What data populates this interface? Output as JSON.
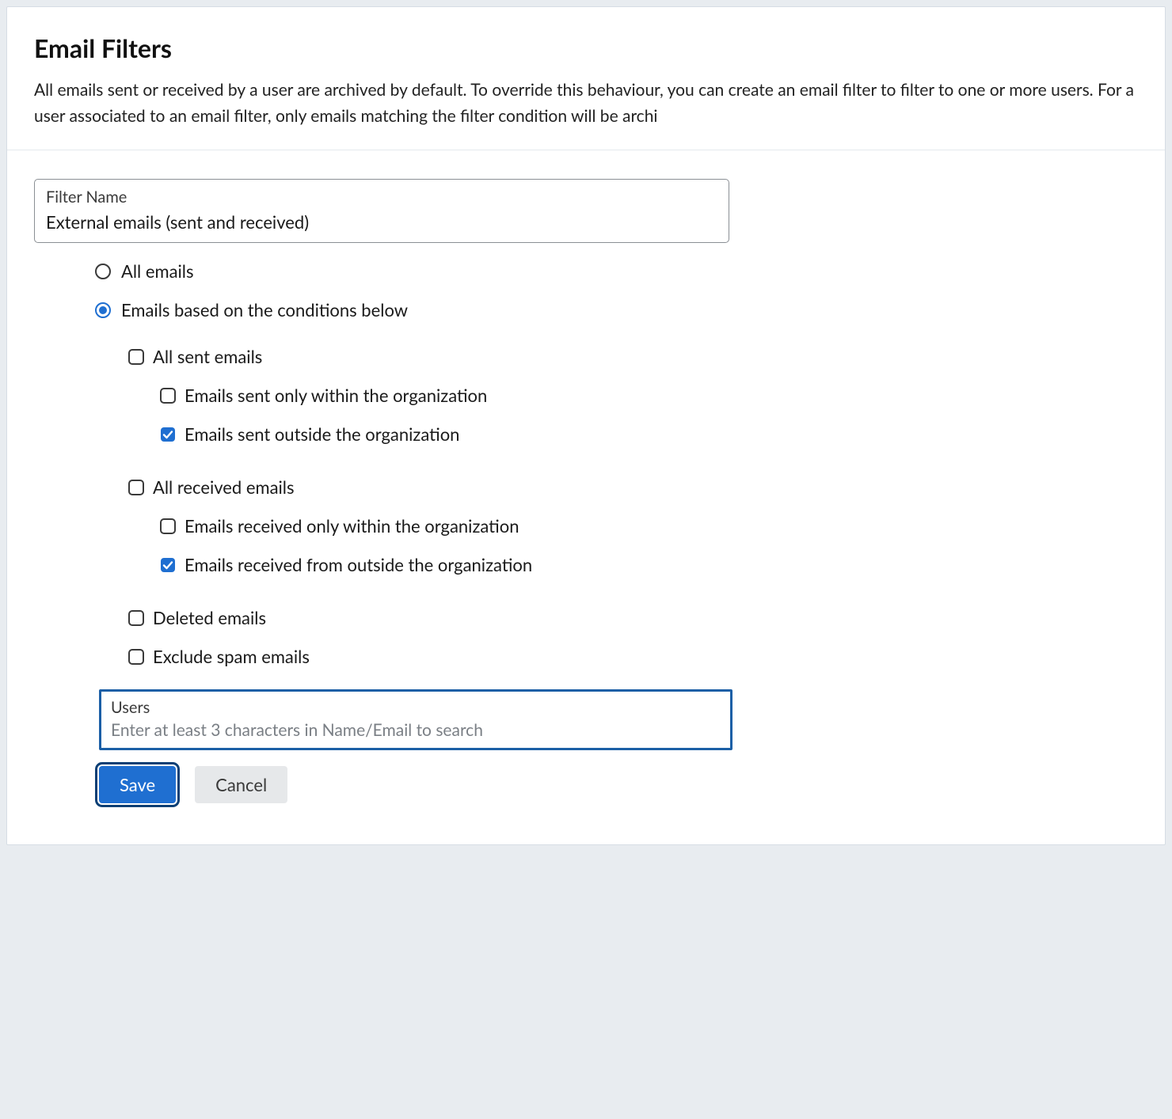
{
  "header": {
    "title": "Email Filters",
    "description": "All emails sent or received by a user are archived by default. To override this behaviour, you can create an email filter to filter to one or more users. For a user associated to an email filter, only emails matching the filter condition will be archi"
  },
  "filter_name_field": {
    "label": "Filter Name",
    "value": "External emails (sent and received)"
  },
  "scope_radios": {
    "selected": "conditions",
    "options": {
      "all": "All emails",
      "conditions": "Emails based on the conditions below"
    }
  },
  "conditions": {
    "all_sent": {
      "label": "All sent emails",
      "checked": false
    },
    "sent_within": {
      "label": "Emails sent only within the organization",
      "checked": false
    },
    "sent_outside": {
      "label": "Emails sent outside the organization",
      "checked": true
    },
    "all_received": {
      "label": "All received emails",
      "checked": false
    },
    "received_within": {
      "label": "Emails received only within the organization",
      "checked": false
    },
    "received_outside": {
      "label": "Emails received from outside the organization",
      "checked": true
    },
    "deleted": {
      "label": "Deleted emails",
      "checked": false
    },
    "exclude_spam": {
      "label": "Exclude spam emails",
      "checked": false
    }
  },
  "users_field": {
    "label": "Users",
    "placeholder": "Enter at least 3 characters in Name/Email to search",
    "value": ""
  },
  "buttons": {
    "save": "Save",
    "cancel": "Cancel"
  },
  "colors": {
    "accent": "#1f6fd1",
    "focus_border": "#1b5fa6"
  }
}
